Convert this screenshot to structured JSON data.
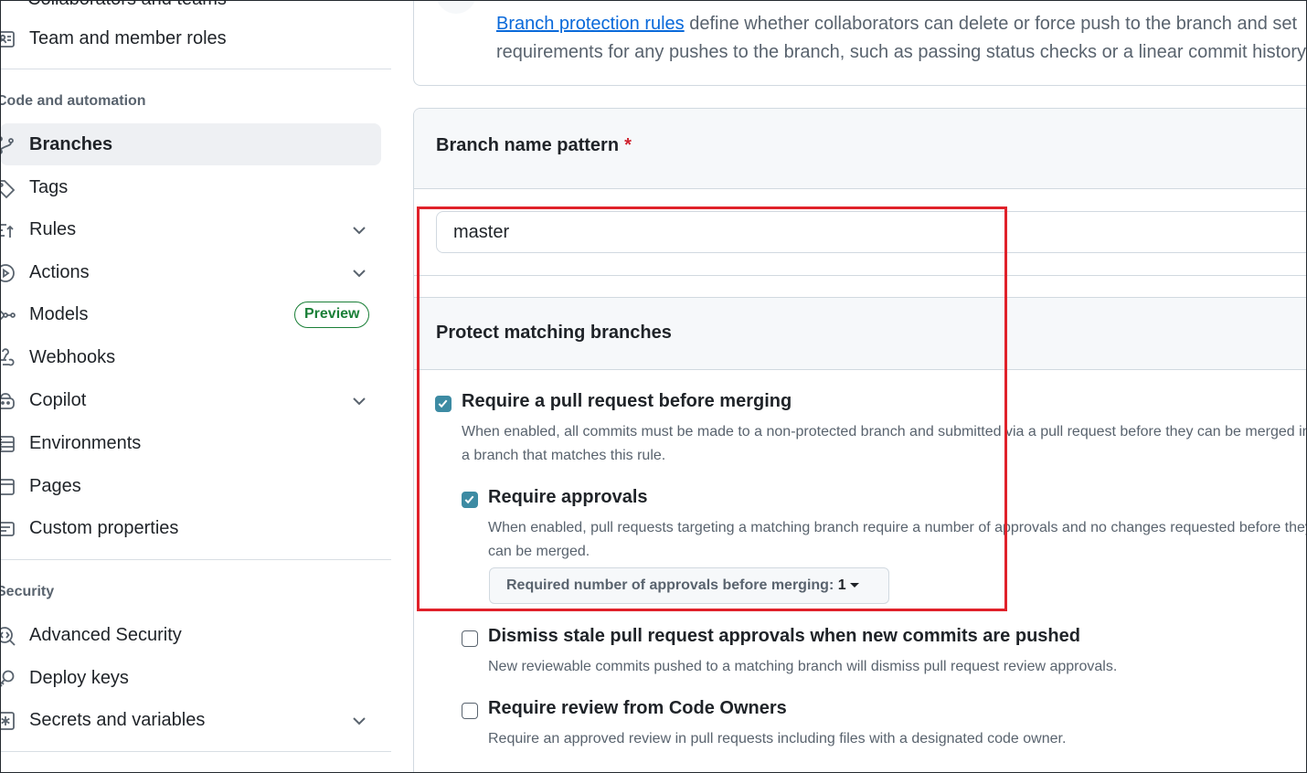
{
  "sidebar": {
    "cut_item": "Collaborators and teams",
    "items_top": [
      {
        "label": "Team and member roles",
        "icon": "person-list-icon"
      }
    ],
    "section_code": "Code and automation",
    "items_code": [
      {
        "label": "Branches",
        "icon": "git-branch-icon",
        "active": true
      },
      {
        "label": "Tags",
        "icon": "tag-icon"
      },
      {
        "label": "Rules",
        "icon": "rules-icon",
        "expandable": true
      },
      {
        "label": "Actions",
        "icon": "play-icon",
        "expandable": true
      },
      {
        "label": "Models",
        "icon": "models-icon",
        "badge": "Preview"
      },
      {
        "label": "Webhooks",
        "icon": "webhook-icon"
      },
      {
        "label": "Copilot",
        "icon": "copilot-icon",
        "expandable": true
      },
      {
        "label": "Environments",
        "icon": "server-icon"
      },
      {
        "label": "Pages",
        "icon": "browser-icon"
      },
      {
        "label": "Custom properties",
        "icon": "note-icon"
      }
    ],
    "section_security": "Security",
    "items_security": [
      {
        "label": "Advanced Security",
        "icon": "codescan-icon"
      },
      {
        "label": "Deploy keys",
        "icon": "key-icon"
      },
      {
        "label": "Secrets and variables",
        "icon": "asterisk-icon",
        "expandable": true
      }
    ]
  },
  "intro": {
    "link_text": "Branch protection rules",
    "line1_rest": " define whether collaborators can delete or force push to the branch and set",
    "line2": "requirements for any pushes to the branch, such as passing status checks or a linear commit history."
  },
  "branch_pattern": {
    "title": "Branch name pattern",
    "required_mark": "*",
    "value": "master"
  },
  "protect": {
    "title": "Protect matching branches",
    "options": [
      {
        "title": "Require a pull request before merging",
        "checked": true,
        "desc_line1": "When enabled, all commits must be made to a non-protected branch and submitted via a pull request before they can be merged into",
        "desc_line2": "a branch that matches this rule."
      },
      {
        "title": "Require approvals",
        "checked": true,
        "desc_line1": "When enabled, pull requests targeting a matching branch require a number of approvals and no changes requested before they",
        "desc_line2": "can be merged."
      },
      {
        "title": "Dismiss stale pull request approvals when new commits are pushed",
        "checked": false,
        "desc_line1": "New reviewable commits pushed to a matching branch will dismiss pull request review approvals."
      },
      {
        "title": "Require review from Code Owners",
        "checked": false,
        "desc_line1": "Require an approved review in pull requests including files with a designated code owner."
      }
    ],
    "approvals_dropdown": {
      "label": "Required number of approvals before merging: ",
      "value": "1"
    }
  },
  "colors": {
    "checkbox": "#3d8ba3",
    "highlight": "#e0212a",
    "link": "#0969da",
    "badge": "#1a7f37"
  }
}
